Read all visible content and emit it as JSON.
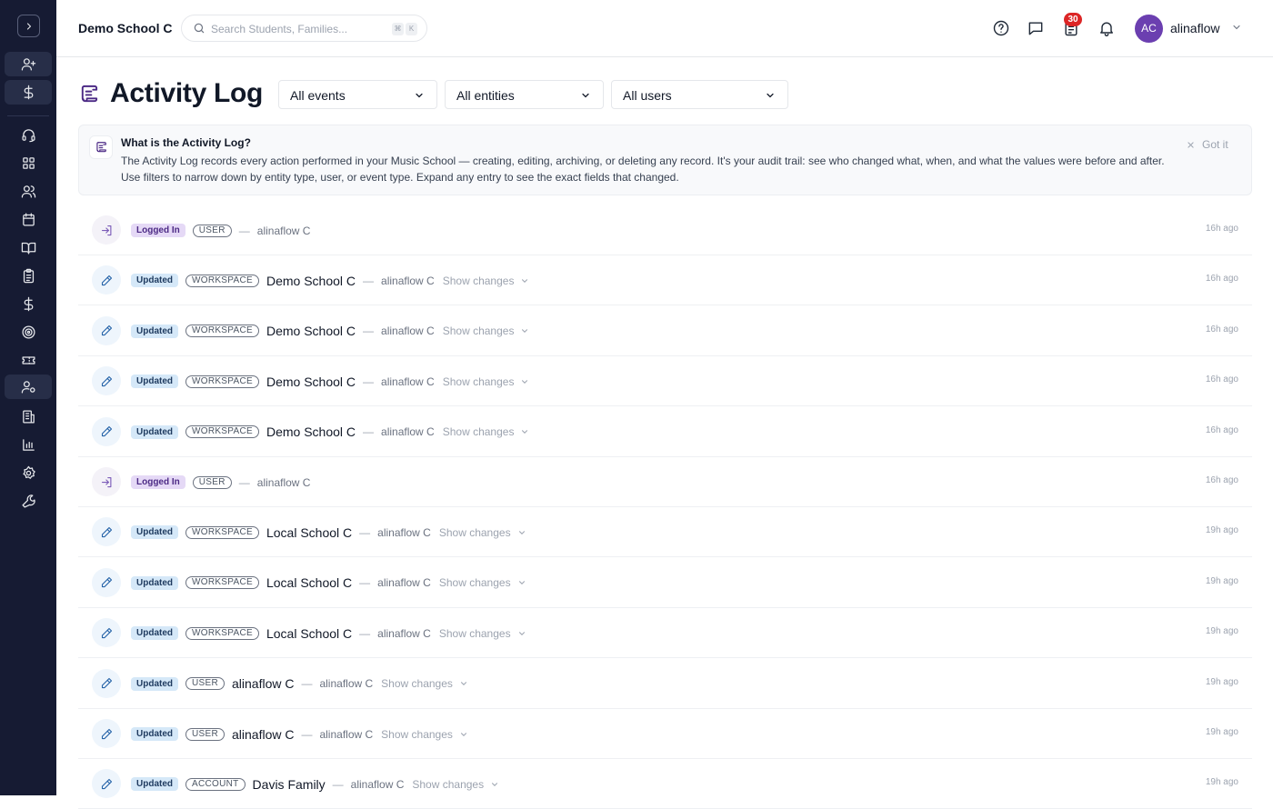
{
  "header": {
    "school_name": "Demo School C",
    "search_placeholder": "Search Students, Families...",
    "kbd_cmd": "⌘",
    "kbd_k": "K",
    "tasks_badge": "30",
    "avatar_initials": "AC",
    "user_name": "alinaflow"
  },
  "page": {
    "title": "Activity Log",
    "filters": {
      "events": "All events",
      "entities": "All entities",
      "users": "All users"
    }
  },
  "info": {
    "title": "What is the Activity Log?",
    "text": "The Activity Log records every action performed in your Music School — creating, editing, archiving, or deleting any record. It's your audit trail: see who changed what, when, and what the values were before and after. Use filters to narrow down by entity type, user, or event type. Expand any entry to see the exact fields that changed.",
    "dismiss": "Got it"
  },
  "sidebar": {
    "icons": [
      "user-plus-icon",
      "dollar-icon",
      "headset-icon",
      "dashboard-icon",
      "users-icon",
      "calendar-icon",
      "book-icon",
      "clipboard-icon",
      "dollar-icon",
      "target-icon",
      "ticket-icon",
      "user-settings-icon",
      "building-icon",
      "chart-icon",
      "gear-icon",
      "wrench-icon"
    ]
  },
  "entries": [
    {
      "action": "Logged In",
      "entity": "USER",
      "name": "",
      "user": "alinaflow C",
      "show": "",
      "time": "16h ago"
    },
    {
      "action": "Updated",
      "entity": "WORKSPACE",
      "name": "Demo School C",
      "user": "alinaflow C",
      "show": "Show changes",
      "time": "16h ago"
    },
    {
      "action": "Updated",
      "entity": "WORKSPACE",
      "name": "Demo School C",
      "user": "alinaflow C",
      "show": "Show changes",
      "time": "16h ago"
    },
    {
      "action": "Updated",
      "entity": "WORKSPACE",
      "name": "Demo School C",
      "user": "alinaflow C",
      "show": "Show changes",
      "time": "16h ago"
    },
    {
      "action": "Updated",
      "entity": "WORKSPACE",
      "name": "Demo School C",
      "user": "alinaflow C",
      "show": "Show changes",
      "time": "16h ago"
    },
    {
      "action": "Logged In",
      "entity": "USER",
      "name": "",
      "user": "alinaflow C",
      "show": "",
      "time": "16h ago"
    },
    {
      "action": "Updated",
      "entity": "WORKSPACE",
      "name": "Local School C",
      "user": "alinaflow C",
      "show": "Show changes",
      "time": "19h ago"
    },
    {
      "action": "Updated",
      "entity": "WORKSPACE",
      "name": "Local School C",
      "user": "alinaflow C",
      "show": "Show changes",
      "time": "19h ago"
    },
    {
      "action": "Updated",
      "entity": "WORKSPACE",
      "name": "Local School C",
      "user": "alinaflow C",
      "show": "Show changes",
      "time": "19h ago"
    },
    {
      "action": "Updated",
      "entity": "USER",
      "name": "alinaflow C",
      "user": "alinaflow C",
      "show": "Show changes",
      "time": "19h ago"
    },
    {
      "action": "Updated",
      "entity": "USER",
      "name": "alinaflow C",
      "user": "alinaflow C",
      "show": "Show changes",
      "time": "19h ago"
    },
    {
      "action": "Updated",
      "entity": "ACCOUNT",
      "name": "Davis Family",
      "user": "alinaflow C",
      "show": "Show changes",
      "time": "19h ago"
    }
  ]
}
